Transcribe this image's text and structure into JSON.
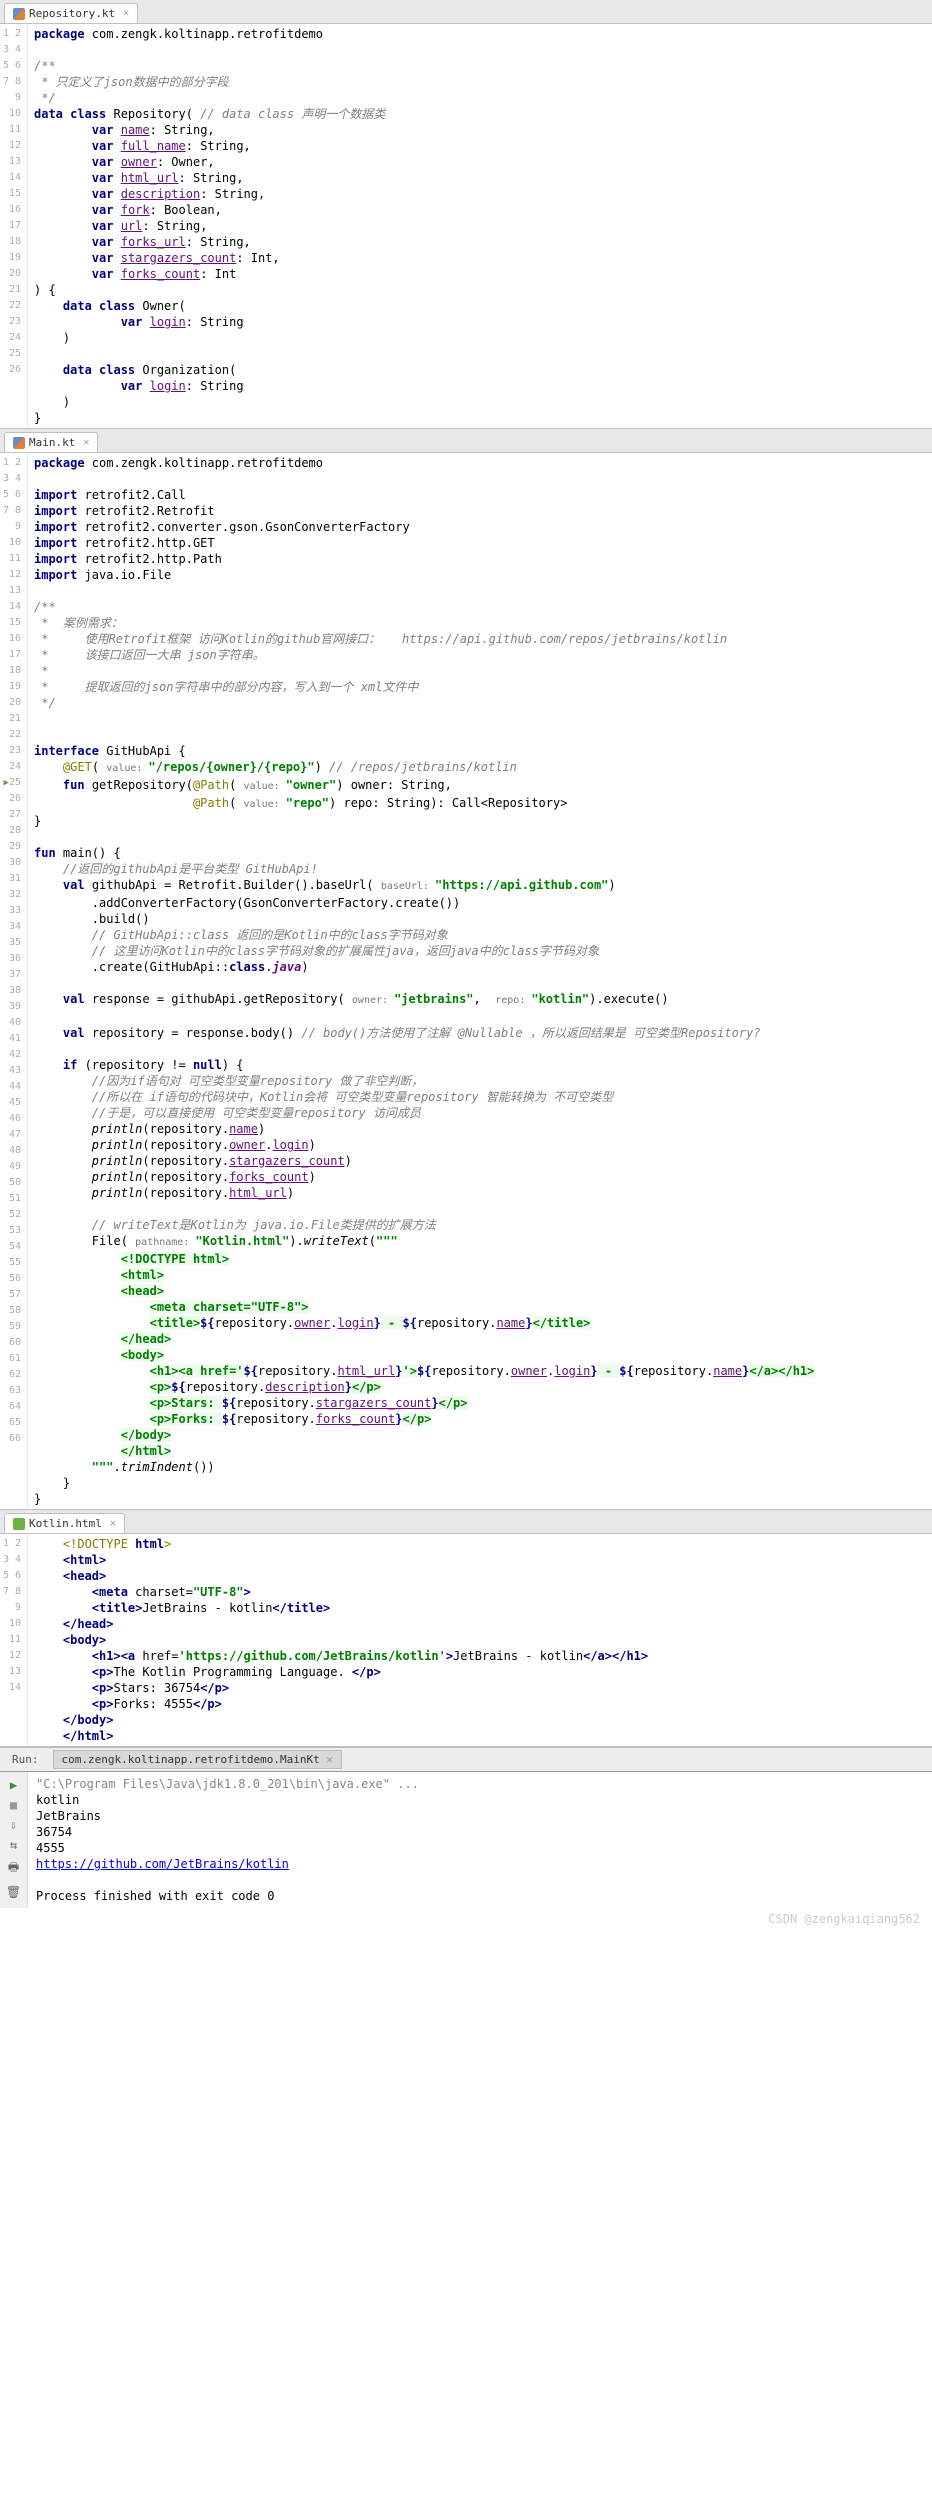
{
  "tabs": {
    "repo": "Repository.kt",
    "main": "Main.kt",
    "html": "Kotlin.html"
  },
  "repo_code": {
    "l1": "package",
    "l1b": " com.zengk.koltinapp.retrofitdemo",
    "l3": "/**",
    "l4": " * 只定义了json数据中的部分字段",
    "l5": " */",
    "l6a": "data class",
    "l6b": " Repository( ",
    "l6c": "// data class 声明一个数据类",
    "l7a": "var",
    "l7b": "name",
    "l7c": ": String,",
    "l8a": "var",
    "l8b": "full_name",
    "l8c": ": String,",
    "l9a": "var",
    "l9b": "owner",
    "l9c": ": Owner,",
    "l10a": "var",
    "l10b": "html_url",
    "l10c": ": String,",
    "l11a": "var",
    "l11b": "description",
    "l11c": ": String,",
    "l12a": "var",
    "l12b": "fork",
    "l12c": ": Boolean,",
    "l13a": "var",
    "l13b": "url",
    "l13c": ": String,",
    "l14a": "var",
    "l14b": "forks_url",
    "l14c": ": String,",
    "l15a": "var",
    "l15b": "stargazers_count",
    "l15c": ": Int,",
    "l16a": "var",
    "l16b": "forks_count",
    "l16c": ": Int",
    "l17": ") {",
    "l18a": "data class",
    "l18b": " Owner(",
    "l19a": "var",
    "l19b": "login",
    "l19c": ": String",
    "l20": ")",
    "l22a": "data class",
    "l22b": " Organization(",
    "l23a": "var",
    "l23b": "login",
    "l23c": ": String",
    "l24": ")",
    "l25": "}"
  },
  "main_code": {
    "l1a": "package",
    "l1b": " com.zengk.koltinapp.retrofitdemo",
    "l3a": "import",
    "l3b": " retrofit2.Call",
    "l4a": "import",
    "l4b": " retrofit2.Retrofit",
    "l5a": "import",
    "l5b": " retrofit2.converter.gson.GsonConverterFactory",
    "l6a": "import",
    "l6b": " retrofit2.http.GET",
    "l7a": "import",
    "l7b": " retrofit2.http.Path",
    "l8a": "import",
    "l8b": " java.io.File",
    "l10": "/**",
    "l11": " *  案例需求：",
    "l12": " *     使用Retrofit框架 访问Kotlin的github官网接口：   https://api.github.com/repos/jetbrains/kotlin",
    "l13": " *     该接口返回一大串 json字符串。",
    "l14": " *",
    "l15": " *     提取返回的json字符串中的部分内容，写入到一个 xml文件中",
    "l16": " */",
    "l19a": "interface",
    "l19b": " GitHubApi {",
    "l20a": "@GET",
    "l20b": "( ",
    "l20h": "value: ",
    "l20c": "\"/repos/{owner}/{repo}\"",
    "l20d": ") ",
    "l20e": "// /repos/jetbrains/kotlin",
    "l21a": "fun",
    "l21b": " getRepository(",
    "l21c": "@Path",
    "l21d": "( ",
    "l21h": "value: ",
    "l21e": "\"owner\"",
    "l21f": ") owner: String,",
    "l22a": "@Path",
    "l22b": "( ",
    "l22h": "value: ",
    "l22c": "\"repo\"",
    "l22d": ") repo: String): Call<Repository>",
    "l23": "}",
    "l25a": "fun",
    "l25b": " main() {",
    "l26": "//返回的githubApi是平台类型 GitHubApi!",
    "l27a": "val",
    "l27b": " githubApi = Retrofit.Builder().baseUrl( ",
    "l27h": "baseUrl: ",
    "l27c": "\"https://api.github.com\"",
    "l27d": ")",
    "l28": ".addConverterFactory(GsonConverterFactory.create())",
    "l29": ".build()",
    "l30": "// GitHubApi::class 返回的是Kotlin中的class字节码对象",
    "l31": "// 这里访问Kotlin中的class字节码对象的扩展属性java，返回java中的class字节码对象",
    "l32a": ".create(GitHubApi::",
    "l32b": "class",
    "l32c": ".",
    "l32d": "java",
    "l32e": ")",
    "l34a": "val",
    "l34b": " response = githubApi.getRepository( ",
    "l34h1": "owner: ",
    "l34c": "\"jetbrains\"",
    "l34d": ",  ",
    "l34h2": "repo: ",
    "l34e": "\"kotlin\"",
    "l34f": ").execute()",
    "l36a": "val",
    "l36b": " repository = response.body() ",
    "l36c": "// body()方法使用了注解 @Nullable ，所以返回结果是 可空类型Repository?",
    "l38a": "if",
    "l38b": " (repository != ",
    "l38c": "null",
    "l38d": ") {",
    "l39": "//因为if语句对 可空类型变量repository 做了非空判断，",
    "l40": "//所以在 if语句的代码块中，Kotlin会将 可空类型变量repository 智能转换为 不可空类型",
    "l41": "//于是，可以直接使用 可空类型变量repository 访问成员",
    "l42a": "println",
    "l42b": "(repository.",
    "l42c": "name",
    "l42d": ")",
    "l43a": "println",
    "l43b": "(repository.",
    "l43c": "owner",
    "l43d": ".",
    "l43e": "login",
    "l43f": ")",
    "l44a": "println",
    "l44b": "(repository.",
    "l44c": "stargazers_count",
    "l44d": ")",
    "l45a": "println",
    "l45b": "(repository.",
    "l45c": "forks_count",
    "l45d": ")",
    "l46a": "println",
    "l46b": "(repository.",
    "l46c": "html_url",
    "l46d": ")",
    "l48": "// writeText是Kotlin为 java.io.File类提供的扩展方法",
    "l49a": "File( ",
    "l49h": "pathname: ",
    "l49b": "\"Kotlin.html\"",
    "l49c": ").",
    "l49d": "writeText",
    "l49e": "(",
    "l49f": "\"\"\"",
    "l50": "<!DOCTYPE html>",
    "l51": "<html>",
    "l52": "<head>",
    "l53": "<meta charset=\"UTF-8\">",
    "l54a": "<title>",
    "l54b": "${",
    "l54c": "repository.",
    "l54d": "owner",
    "l54e": ".",
    "l54f": "login",
    "l54g": "}",
    "l54h": " - ",
    "l54i": "${",
    "l54j": "repository.",
    "l54k": "name",
    "l54l": "}",
    "l54m": "</title>",
    "l55": "</head>",
    "l56": "<body>",
    "l57a": "<h1><a href='",
    "l57b": "${",
    "l57c": "repository.",
    "l57d": "html_url",
    "l57e": "}",
    "l57f": "'>",
    "l57g": "${",
    "l57h": "repository.",
    "l57i": "owner",
    "l57j": ".",
    "l57k": "login",
    "l57l": "}",
    "l57m": " - ",
    "l57n": "${",
    "l57o": "repository.",
    "l57p": "name",
    "l57q": "}",
    "l57r": "</a></h1>",
    "l58a": "<p>",
    "l58b": "${",
    "l58c": "repository.",
    "l58d": "description",
    "l58e": "}",
    "l58f": "</p>",
    "l59a": "<p>Stars: ",
    "l59b": "${",
    "l59c": "repository.",
    "l59d": "stargazers_count",
    "l59e": "}",
    "l59f": "</p>",
    "l60a": "<p>Forks: ",
    "l60b": "${",
    "l60c": "repository.",
    "l60d": "forks_count",
    "l60e": "}",
    "l60f": "</p>",
    "l61": "</body>",
    "l62": "</html>",
    "l63a": "\"\"\"",
    "l63b": ".",
    "l63c": "trimIndent",
    "l63d": "())",
    "l64": "}",
    "l65": "}"
  },
  "html_code": {
    "l1a": "<!DOCTYPE ",
    "l1b": "html",
    "l1c": ">",
    "l2a": "<html>",
    "l3a": "<head>",
    "l4a": "<meta ",
    "l4b": "charset=",
    "l4c": "\"UTF-8\"",
    "l4d": ">",
    "l5a": "<title>",
    "l5b": "JetBrains - kotlin",
    "l5c": "</title>",
    "l6a": "</head>",
    "l7a": "<body>",
    "l8a": "<h1><a ",
    "l8b": "href=",
    "l8c": "'https://github.com/JetBrains/kotlin'",
    "l8d": ">",
    "l8e": "JetBrains - kotlin",
    "l8f": "</a></h1>",
    "l9a": "<p>",
    "l9b": "The Kotlin Programming Language. ",
    "l9c": "</p>",
    "l10a": "<p>",
    "l10b": "Stars: 36754",
    "l10c": "</p>",
    "l11a": "<p>",
    "l11b": "Forks: 4555",
    "l11c": "</p>",
    "l12a": "</body>",
    "l13a": "</html>"
  },
  "run": {
    "label": "Run:",
    "tab": "com.zengk.koltinapp.retrofitdemo.MainKt",
    "cmd": "\"C:\\Program Files\\Java\\jdk1.8.0_201\\bin\\java.exe\" ...",
    "o1": "kotlin",
    "o2": "JetBrains",
    "o3": "36754",
    "o4": "4555",
    "o5": "https://github.com/JetBrains/kotlin",
    "exit": "Process finished with exit code 0"
  },
  "watermark": "CSDN @zengkaiqiang562"
}
